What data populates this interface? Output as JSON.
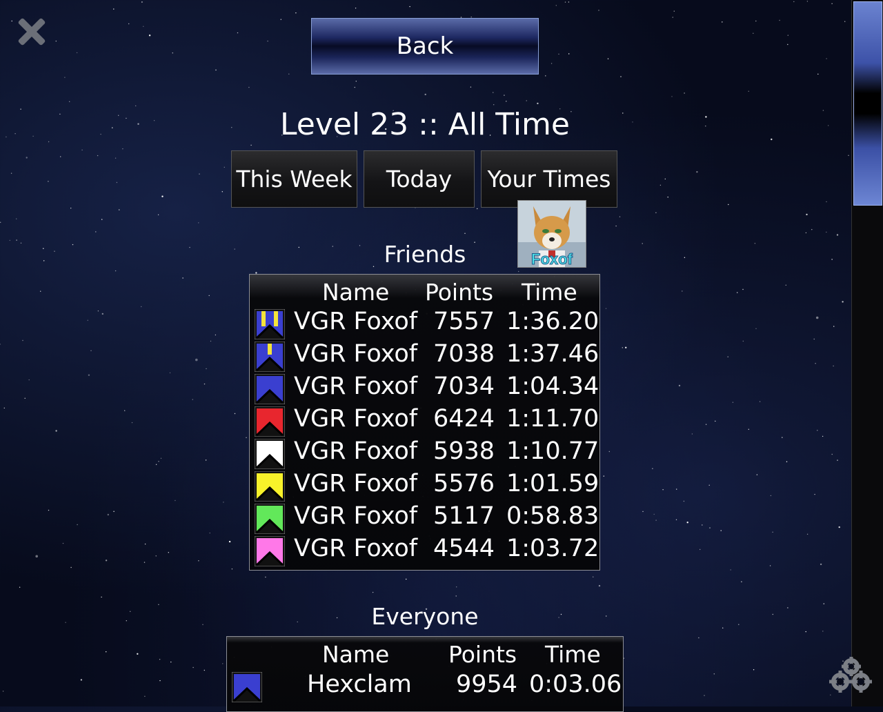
{
  "header": {
    "back_label": "Back",
    "title": "Level 23 :: All Time"
  },
  "tabs": [
    {
      "label": "This Week"
    },
    {
      "label": "Today"
    },
    {
      "label": "Your Times"
    }
  ],
  "friends": {
    "title": "Friends",
    "columns": {
      "name": "Name",
      "points": "Points",
      "time": "Time"
    },
    "rows": [
      {
        "name": "VGR Foxof",
        "points": "7557",
        "time": "1:36.20",
        "badge": {
          "fill": "#3a3fd0",
          "stripe": "#f5e43a",
          "stripes": 2
        }
      },
      {
        "name": "VGR Foxof",
        "points": "7038",
        "time": "1:37.46",
        "badge": {
          "fill": "#3a3fd0",
          "stripe": "#f5e43a",
          "stripes": 1
        }
      },
      {
        "name": "VGR Foxof",
        "points": "7034",
        "time": "1:04.34",
        "badge": {
          "fill": "#3a3fd0",
          "stripe": "",
          "stripes": 0
        }
      },
      {
        "name": "VGR Foxof",
        "points": "6424",
        "time": "1:11.70",
        "badge": {
          "fill": "#e8262e",
          "stripe": "",
          "stripes": 0
        }
      },
      {
        "name": "VGR Foxof",
        "points": "5938",
        "time": "1:10.77",
        "badge": {
          "fill": "#ffffff",
          "stripe": "",
          "stripes": 0
        }
      },
      {
        "name": "VGR Foxof",
        "points": "5576",
        "time": "1:01.59",
        "badge": {
          "fill": "#f8f22a",
          "stripe": "",
          "stripes": 0
        }
      },
      {
        "name": "VGR Foxof",
        "points": "5117",
        "time": "0:58.83",
        "badge": {
          "fill": "#62e85a",
          "stripe": "",
          "stripes": 0
        }
      },
      {
        "name": "VGR Foxof",
        "points": "4544",
        "time": "1:03.72",
        "badge": {
          "fill": "#ff78e8",
          "stripe": "",
          "stripes": 0
        }
      }
    ]
  },
  "avatar": {
    "label": "Foxof"
  },
  "everyone": {
    "title": "Everyone",
    "columns": {
      "name": "Name",
      "points": "Points",
      "time": "Time"
    },
    "rows": [
      {
        "name": "Hexclam",
        "points": "9954",
        "time": "0:03.06",
        "badge": {
          "fill": "#3a3fd0",
          "stripe": "#f5e43a",
          "stripes": 0
        }
      }
    ]
  },
  "icons": {
    "close": "close-icon",
    "settings": "gear-icon"
  }
}
